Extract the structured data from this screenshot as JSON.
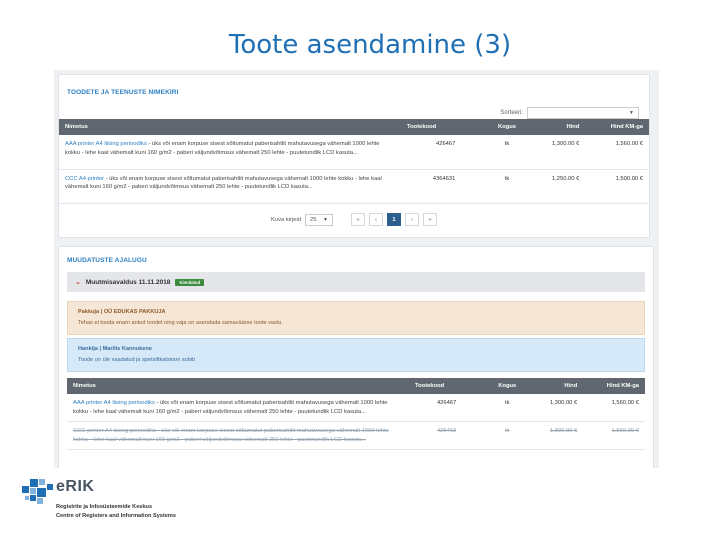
{
  "slide": {
    "title": "Toote asendamine (3)"
  },
  "products_panel": {
    "heading": "TOODETE JA TEENUSTE NIMEKIRI",
    "sort_label": "Sorteeri:",
    "sort_value": "",
    "columns": [
      "Nimetus",
      "Tootekood",
      "Kogus",
      "Hind",
      "Hind KM-ga"
    ],
    "rows": [
      {
        "name": "AAA printer A4 liising perioodiks",
        "desc": " - üks või enam korpuse sisest sõltumatut paberisahtlit mahutavusega vähemalt 1000 lehte kokku - lehe kaal vähemalt kuni 160 g/m2 - paberi väljundvõimsus vähemalt 250 lehte - puutetundlik LCD kasuta...",
        "code": "426467",
        "qty": "tk",
        "price": "1,300.00 €",
        "price_vat": "1,560.00 €"
      },
      {
        "name": "CCC A4 printer",
        "desc": " - üks või enam korpuse sisest sõltumatut paberisahtlit mahutavusega vähemalt 1000 lehte kokku - lehe kaal vähemalt kuni 160 g/m2 - paberi väljundvõimsus vähemalt 250 lehte - puutetundlik LCD kasuta...",
        "code": "4364631",
        "qty": "tk",
        "price": "1,250.00 €",
        "price_vat": "1,500.00 €"
      }
    ],
    "pagination": {
      "per_page_label": "Kuva kirjeid",
      "per_page": "25",
      "first": "«",
      "prev": "‹",
      "current": "1",
      "next": "›",
      "last": "»"
    }
  },
  "history_panel": {
    "heading": "MUUDATUSTE AJALUGU",
    "entry_title": "Muutmisavaldus 11.11.2018",
    "entry_badge": "Kinnitatud",
    "supplier_title": "Pakkuja | OÜ EDUKAS PAKKUJA",
    "supplier_text": "Tehas ei tooda enam antud toodet ning vaja on asendada samaväärse toote vastu.",
    "buyer_title": "Hankija | Marilis Kannukene",
    "buyer_text": "Toode on üle vaadatud ja spetsifikatsioon sobib",
    "columns": [
      "Nimetus",
      "Tootekood",
      "Kogus",
      "Hind",
      "Hind KM-ga"
    ],
    "rows": [
      {
        "name": "AAA printer A4 liising perioodiks",
        "desc": " - üks või enam korpuse sisest sõltumatut paberisahtlit mahutavusega vähemalt 1000 lehte kokku - lehe kaal vähemalt kuni 160 g/m2 - paberi väljundvõimsus vähemalt 250 lehte - puutetundlik LCD kasuta...",
        "code": "426467",
        "qty": "tk",
        "price": "1,300.00 €",
        "price_vat": "1,560.00 €"
      },
      {
        "name": "CCC printer A4 liising perioodiks",
        "desc": " - üks või enam korpuse sisest sõltumatut paberisahtlit mahutavusega vähemalt 1000 lehte kokku - lehe kaal vähemalt kuni 160 g/m2 - paberi väljundvõimsus vähemalt 250 lehte - puutetundlik LCD kasuta...",
        "code": "426463",
        "qty": "tk",
        "price": "1,300.00 €",
        "price_vat": "1,560.00 €"
      }
    ]
  },
  "logo": {
    "name": "eRIK",
    "line1": "Registrite ja Infosüsteemide Keskus",
    "line2": "Centre of Registers and Information Systems",
    "colors": {
      "dark": "#4a5563",
      "blue": "#1f6fb4",
      "light_blue": "#7fb3dd"
    }
  }
}
